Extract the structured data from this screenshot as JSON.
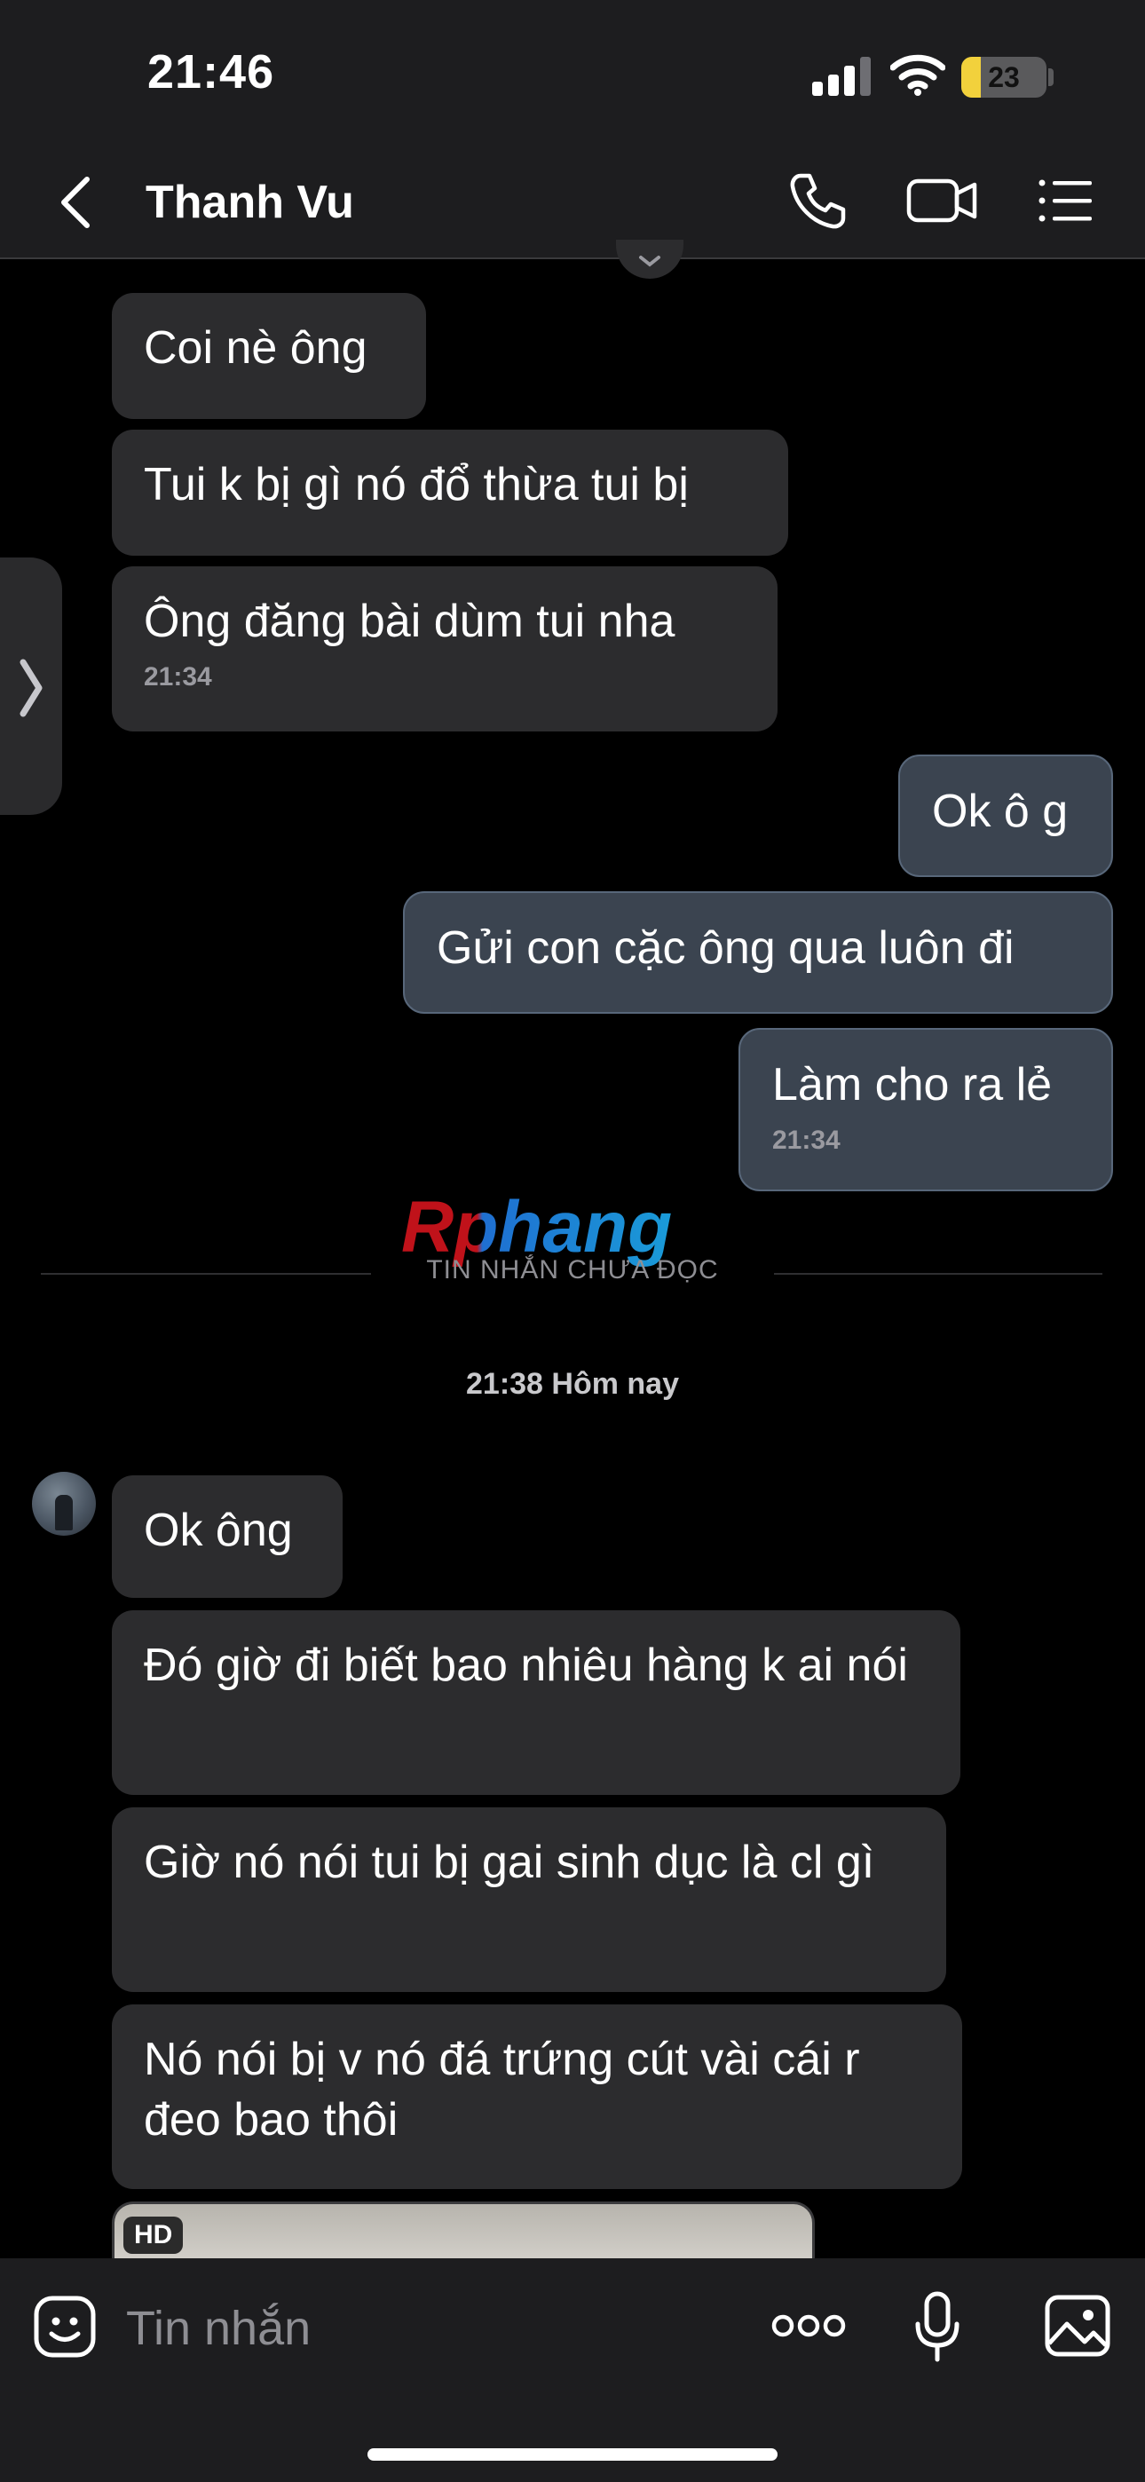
{
  "status_bar": {
    "time": "21:46",
    "battery_level": "23",
    "battery_fraction": 0.23,
    "battery_color": "#f2d13c",
    "icons": [
      "signal-icon",
      "wifi-icon",
      "battery-icon"
    ]
  },
  "header": {
    "title": "Thanh Vu",
    "icons": [
      "back-chevron-icon",
      "phone-icon",
      "video-camera-icon",
      "list-menu-icon"
    ]
  },
  "messages": [
    {
      "direction": "in",
      "text": "Coi nè ông",
      "time": ""
    },
    {
      "direction": "in",
      "text": "Tui k bị gì nó đổ thừa tui bị",
      "time": ""
    },
    {
      "direction": "in",
      "text": "Ông đăng bài dùm tui nha",
      "time": "21:34"
    },
    {
      "direction": "out",
      "text": "Ok ô g",
      "time": ""
    },
    {
      "direction": "out",
      "text": "Gửi con cặc ông qua luôn đi",
      "time": ""
    },
    {
      "direction": "out",
      "text": "Làm cho ra lẻ",
      "time": "21:34"
    },
    {
      "direction": "in",
      "text": "Ok ông",
      "time": ""
    },
    {
      "direction": "in",
      "text": "Đó giờ đi biết bao nhiêu hàng k ai nói",
      "time": ""
    },
    {
      "direction": "in",
      "text": "Giờ nó nói tui bị gai sinh dục là cl gì",
      "time": ""
    },
    {
      "direction": "in",
      "text": "Nó nói bị v nó đá trứng cút vài cái r đeo bao thôi",
      "time": ""
    }
  ],
  "unread_label": "TIN NHẮN CHƯA ĐỌC",
  "watermark": "Rphang",
  "date_separator": "21:38 Hôm nay",
  "media": {
    "badge": "HD"
  },
  "composer": {
    "placeholder": "Tin nhắn",
    "icons": [
      "sticker-emoji-icon",
      "more-options-icon",
      "microphone-icon",
      "image-gallery-icon"
    ]
  },
  "colors": {
    "background": "#000000",
    "bar": "#1d1d1f",
    "incoming_bubble": "#2c2c2e",
    "outgoing_bubble": "#3b4450",
    "outgoing_border": "#58677a"
  }
}
